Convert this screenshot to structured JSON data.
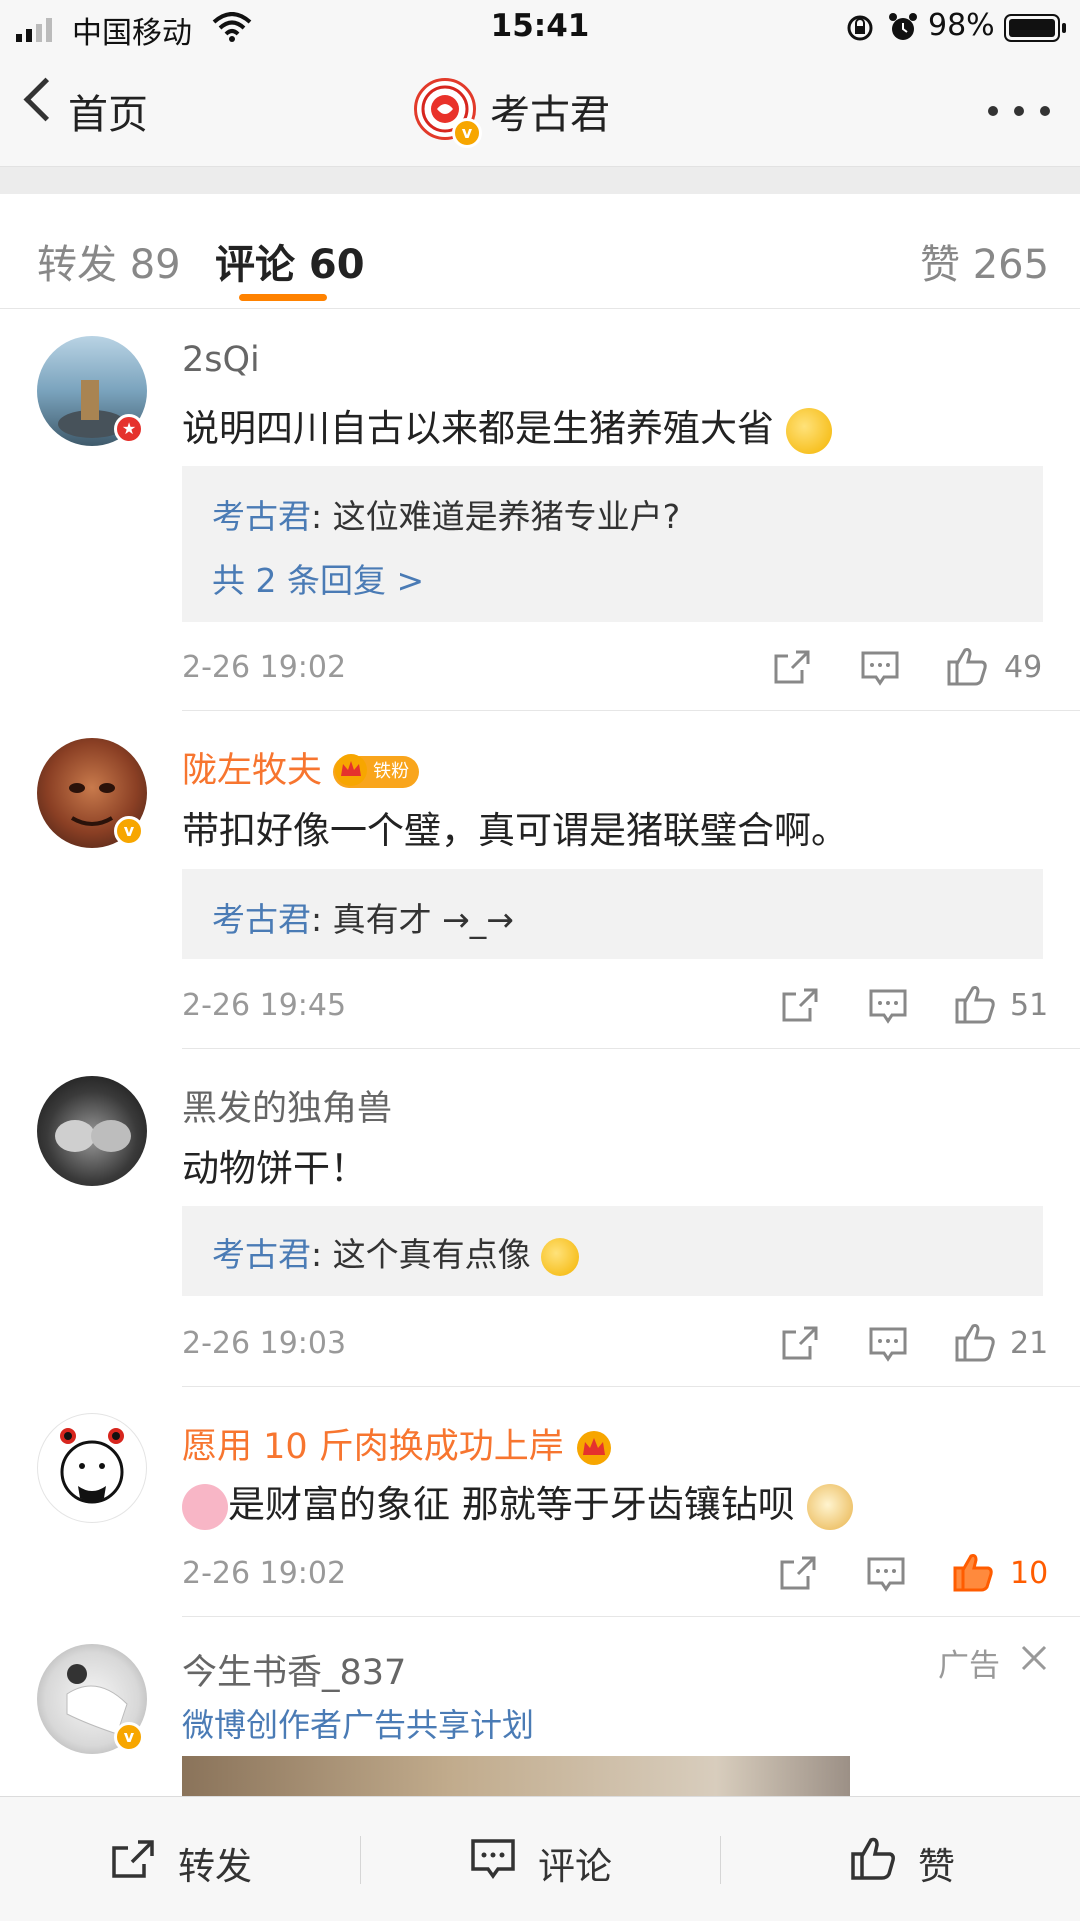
{
  "status_bar": {
    "carrier": "中国移动",
    "time": "15:41",
    "battery": "98%"
  },
  "nav": {
    "back_label": "首页",
    "title": "考古君"
  },
  "tabs": {
    "repost": "转发 89",
    "comments": "评论 60",
    "likes": "赞 265"
  },
  "comments": [
    {
      "username": "2sQi",
      "text": "说明四川自古以来都是生猪养殖大省",
      "reply_author": "考古君",
      "reply_text": ": 这位难道是养猪专业户?",
      "more_replies": "共 2 条回复 >",
      "time": "2-26 19:02",
      "likes": "49"
    },
    {
      "username": "陇左牧夫",
      "fan_badge": "铁粉",
      "text": "带扣好像一个璧，真可谓是猪联璧合啊。",
      "reply_author": "考古君",
      "reply_text": ": 真有才 →_→",
      "time": "2-26 19:45",
      "likes": "51"
    },
    {
      "username": "黑发的独角兽",
      "text": "动物饼干！",
      "reply_author": "考古君",
      "reply_text": ": 这个真有点像",
      "time": "2-26 19:03",
      "likes": "21"
    },
    {
      "username": "愿用 10 斤肉换成功上岸",
      "text": "是财富的象征 那就等于牙齿镶钻呗",
      "time": "2-26 19:02",
      "likes": "10"
    }
  ],
  "ad": {
    "username": "今生书香_837",
    "label": "广告",
    "subtitle": "微博创作者广告共享计划"
  },
  "toolbar": {
    "repost": "转发",
    "comment": "评论",
    "like": "赞"
  },
  "colors": {
    "accent": "#ff8200",
    "link_blue": "#4a7bb5",
    "orange_name": "#f7752f"
  }
}
